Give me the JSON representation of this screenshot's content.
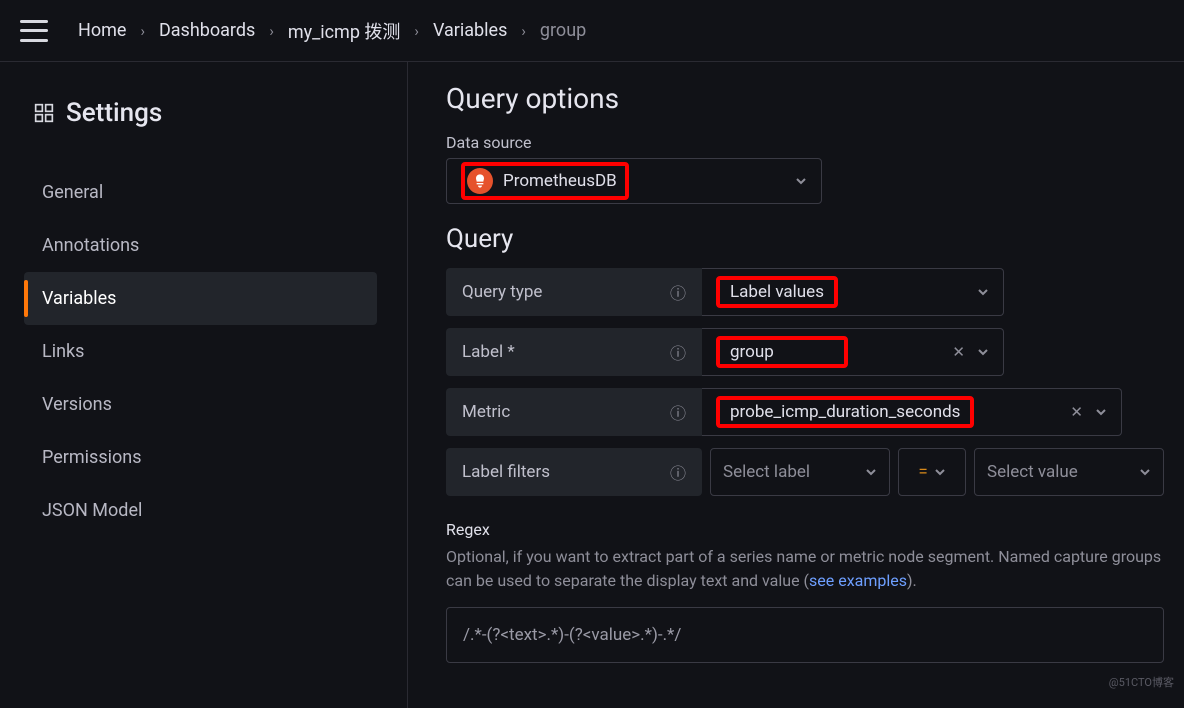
{
  "breadcrumbs": [
    "Home",
    "Dashboards",
    "my_icmp 拨测",
    "Variables",
    "group"
  ],
  "sidebar": {
    "title": "Settings",
    "items": [
      "General",
      "Annotations",
      "Variables",
      "Links",
      "Versions",
      "Permissions",
      "JSON Model"
    ],
    "active_index": 2
  },
  "main": {
    "query_options_title": "Query options",
    "data_source_label": "Data source",
    "data_source_value": "PrometheusDB",
    "query_title": "Query",
    "rows": {
      "query_type": {
        "label": "Query type",
        "value": "Label values"
      },
      "label": {
        "label": "Label *",
        "value": "group"
      },
      "metric": {
        "label": "Metric",
        "value": "probe_icmp_duration_seconds"
      },
      "filters": {
        "label": "Label filters",
        "select_label_ph": "Select label",
        "op": "=",
        "select_value_ph": "Select value"
      }
    },
    "regex": {
      "title": "Regex",
      "hint_prefix": "Optional, if you want to extract part of a series name or metric node segment. Named capture groups can be used to separate the display text and value (",
      "hint_link": "see examples",
      "hint_suffix": ").",
      "value": "/.*-(?<text>.*)-(?<value>.*)-.*/"
    }
  },
  "watermark": "@51CTO博客"
}
